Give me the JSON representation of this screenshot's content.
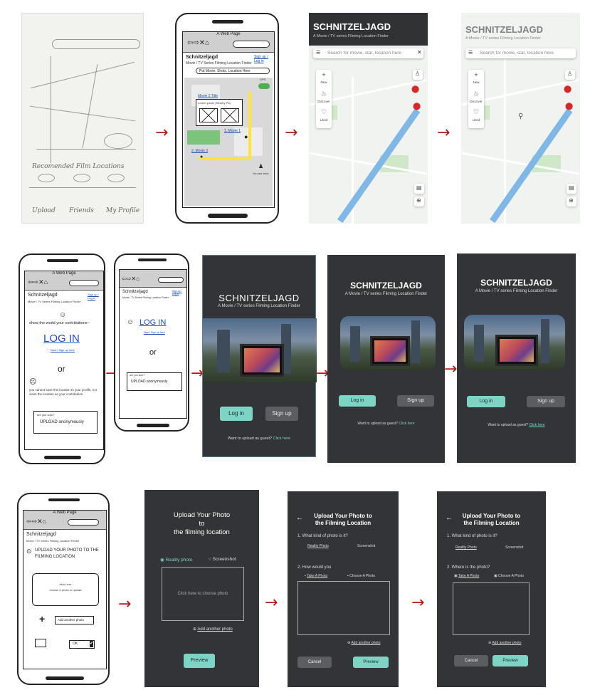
{
  "sketch": {
    "recommended_label": "Recomended Film Locations",
    "nav": [
      "Upload",
      "Friends",
      "My Profile"
    ]
  },
  "row1": {
    "wireframe": {
      "window_title": "A Web Page",
      "app_name": "Schnitzeljagd",
      "app_tagline": "Movie / TV Series Filming Location Finder",
      "signin": "Sign up / Log in",
      "search_placeholder": "Put Movie, Shots, Location Here",
      "toggle_label": "GPS",
      "movie_popup_title": "Movie 2 Title",
      "movie_popup_subtitle": "Lorem ipsum (Nearby Pic)",
      "pin1_label": "1. Movie 1",
      "pin2_label": "2. Movie 3",
      "you_are_here": "You are here"
    },
    "map_screens": [
      {
        "title": "SCHNITZELJAGD",
        "subtitle": "A Movie / TV series Filming Location Finder",
        "search": "Search for movie, star, location here",
        "show_close": true,
        "side": [
          "New",
          "Discover",
          "Liked"
        ]
      },
      {
        "title": "SCHNITZELJAGD",
        "subtitle": "A Movie / TV series Filming Location Finder",
        "search": "Search for movie, star, location here",
        "show_close": false,
        "side": [
          "New",
          "Discover",
          "Liked"
        ]
      }
    ]
  },
  "row2": {
    "wf_login_large": {
      "window_title": "A Web Page",
      "app_name": "Schnitzeljagd",
      "app_tagline": "Movie / TV Series Filming Location Finder",
      "signin": "Sign up / Log in",
      "show_world": "show the world your contributions~",
      "login": "LOG IN",
      "new_signup": "New? Sign up here",
      "or": "or",
      "cannot_save": "you cannot save this location to your profile, nor claim the location as your contribution",
      "are_you_sure": "are you sure?",
      "upload_anon": "UPLOAD anonymously"
    },
    "wf_login_small": {
      "app_name": "Schnitzeljagd",
      "app_tagline": "Movie / TV Series Filming Location Finder",
      "signin": "Sign up / Log in",
      "login": "LOG IN",
      "new_signup": "New? Sign up here",
      "or": "or",
      "are_you_sure": "are you sure?",
      "upload_anon": "UPLOAD anonymously"
    },
    "dark_login": [
      {
        "title": "SCHNITZELJAGD",
        "subtitle": "A Movie / TV series Filming Location Finder",
        "login": "Log in",
        "signup": "Sign up",
        "guest": "Want to upload as guest?",
        "guest_link": "Click here"
      },
      {
        "title": "SCHNITZELJAGD",
        "subtitle": "A Movie / TV series Filming Location Finder",
        "login": "Log in",
        "signup": "Sign up",
        "guest": "Want to upload as guest?",
        "guest_link": "Click here"
      },
      {
        "title": "SCHNITZELJAGD",
        "subtitle": "A Movie / TV series Filming Location Finder",
        "login": "Log in",
        "signup": "Sign up",
        "guest": "Want to upload as guest?",
        "guest_link": "Click here"
      }
    ]
  },
  "row3": {
    "wf_upload": {
      "window_title": "A Web Page",
      "app_name": "Schnitzeljagd",
      "app_tagline": "Movie / TV Series Filming Location Finder",
      "heading": "UPLOAD YOUR PHOTO TO THE FILMING LOCATION",
      "drop_1": "click here",
      "drop_2": "choose a photo to upload",
      "add_another": "Add another photo",
      "ok": "OK"
    },
    "up1": {
      "title_1": "Upload Your Photo",
      "title_2": "to",
      "title_3": "the filming location",
      "radio_reality": "Reality photo",
      "radio_screenshot": "Screenshot",
      "choose": "Click here to choose photo",
      "add_another": "Add another photo",
      "preview": "Preview"
    },
    "up2": {
      "title_1": "Upload Your Photo to",
      "title_2": "the Filming Location",
      "q1": "1.   What kind of photo is it?",
      "opt_reality": "Reality Photo",
      "opt_screenshot": "Screenshot",
      "q2": "2.   How would you",
      "opt_take": "Take A Photo",
      "opt_choose": "Choose A Photo",
      "add_another": "Add another photo",
      "cancel": "Cancel",
      "preview": "Preview"
    },
    "up3": {
      "title_1": "Upload Your Photo to",
      "title_2": "the Filming Location",
      "q1": "1.   What kind of photo is it?",
      "opt_reality": "Reality Photo",
      "opt_screenshot": "Screenshot",
      "q2": "2.   Where is the photo?",
      "opt_take": "Take A Photo",
      "opt_choose": "Choose A Photo",
      "add_another": "Add another photo",
      "cancel": "Cancel",
      "preview": "Preview"
    }
  },
  "colors": {
    "arrow": "#b31b1b",
    "teal": "#7dd3c4",
    "dark": "#333437"
  }
}
